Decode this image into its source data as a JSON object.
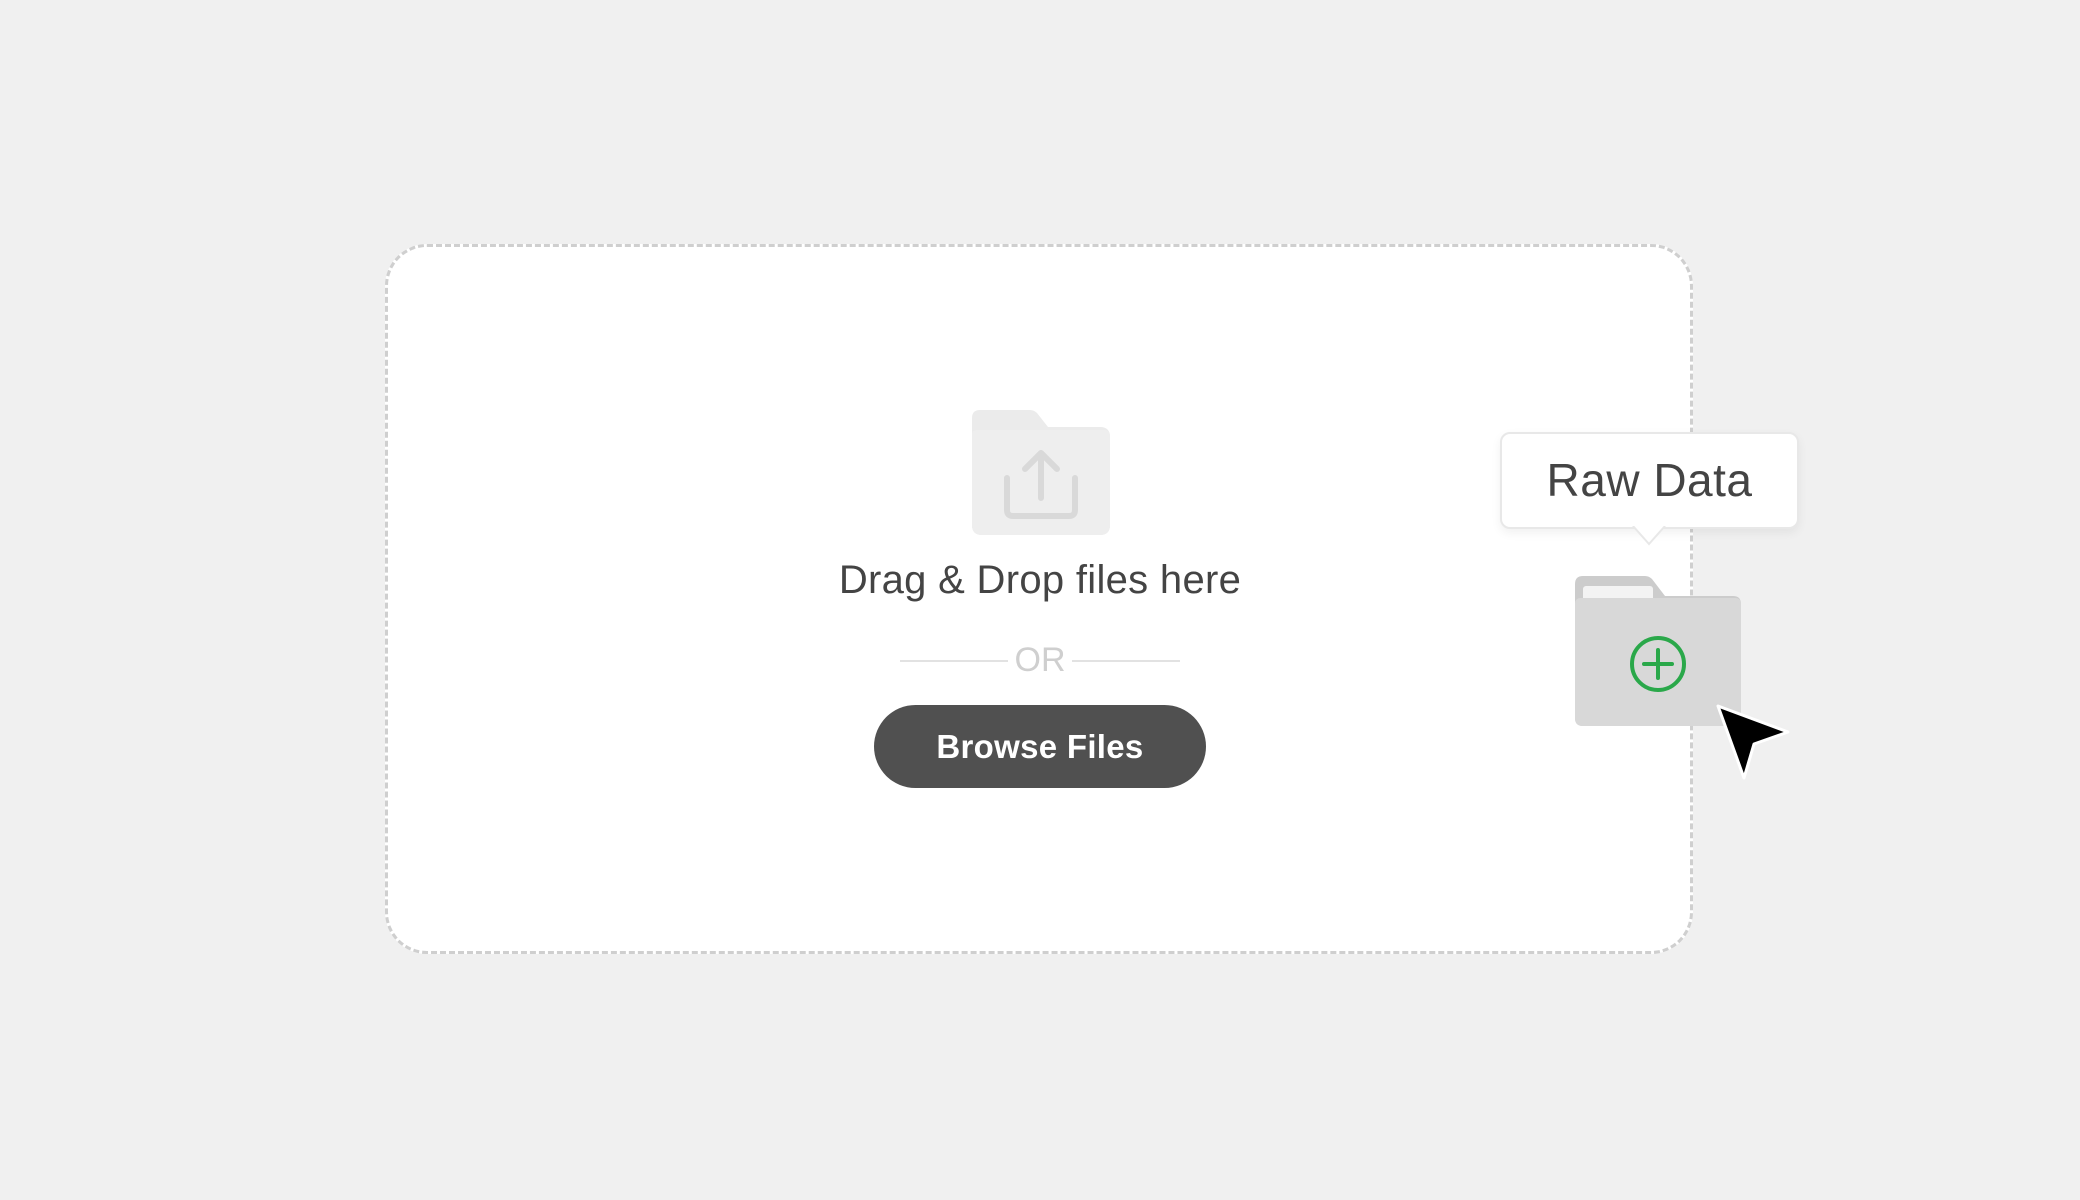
{
  "dropzone": {
    "instruction": "Drag & Drop files here",
    "divider_text": "OR",
    "browse_label": "Browse Files"
  },
  "drag_item": {
    "label": "Raw Data"
  },
  "icons": {
    "upload": "folder-upload-icon",
    "dragged_folder": "folder-add-icon",
    "add": "plus-circle-icon",
    "pointer": "cursor-arrow-icon"
  },
  "colors": {
    "background": "#f0f0f0",
    "dropzone_fill": "#ffffff",
    "dropzone_border": "#cfcfcf",
    "button": "#505050",
    "accent_add": "#2aa84a"
  }
}
